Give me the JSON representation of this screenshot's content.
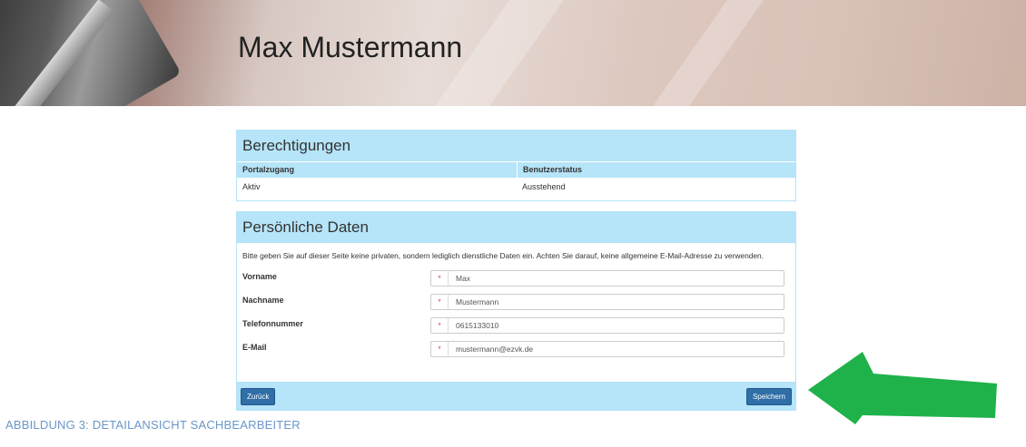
{
  "header": {
    "title": "Max Mustermann"
  },
  "permissions": {
    "title": "Berechtigungen",
    "columns": [
      "Portalzugang",
      "Benutzerstatus"
    ],
    "values": [
      "Aktiv",
      "Ausstehend"
    ]
  },
  "personal": {
    "title": "Persönliche Daten",
    "note": "Bitte geben Sie auf dieser Seite keine privaten, sondern lediglich dienstliche Daten ein. Achten Sie darauf, keine allgemeine E-Mail-Adresse zu verwenden.",
    "required_marker": "*",
    "fields": [
      {
        "label": "Vorname",
        "value": "Max"
      },
      {
        "label": "Nachname",
        "value": "Mustermann"
      },
      {
        "label": "Telefonnummer",
        "value": "0615133010"
      },
      {
        "label": "E-Mail",
        "value": "mustermann@ezvk.de"
      }
    ],
    "back_label": "Zurück",
    "save_label": "Speichern"
  },
  "caption": "ABBILDUNG 3: DETAILANSICHT SACHBEARBEITER",
  "colors": {
    "panel_header": "#b6e4f8",
    "button": "#2f6ea7",
    "arrow": "#1fb24a",
    "caption": "#6a97c8"
  },
  "icons": {
    "arrow": "green-arrow-icon"
  }
}
